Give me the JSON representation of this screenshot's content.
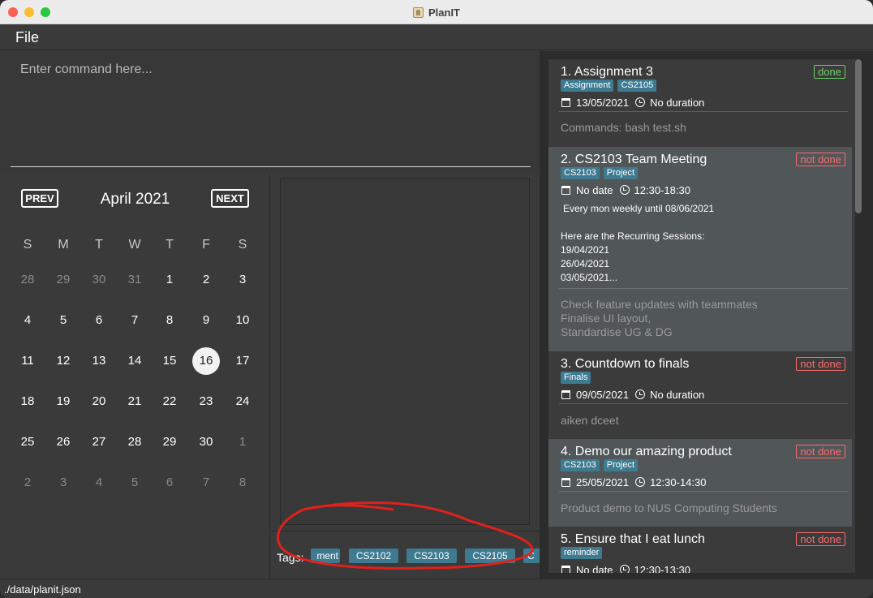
{
  "window": {
    "title": "PlanIT"
  },
  "menu": {
    "file": "File"
  },
  "command": {
    "placeholder": "Enter command here..."
  },
  "calendar": {
    "prev_label": "PREV",
    "next_label": "NEXT",
    "month_label": "April 2021",
    "weekdays": [
      "S",
      "M",
      "T",
      "W",
      "T",
      "F",
      "S"
    ],
    "weeks": [
      [
        "28",
        "29",
        "30",
        "31",
        "1",
        "2",
        "3"
      ],
      [
        "4",
        "5",
        "6",
        "7",
        "8",
        "9",
        "10"
      ],
      [
        "11",
        "12",
        "13",
        "14",
        "15",
        "16",
        "17"
      ],
      [
        "18",
        "19",
        "20",
        "21",
        "22",
        "23",
        "24"
      ],
      [
        "25",
        "26",
        "27",
        "28",
        "29",
        "30",
        "1"
      ],
      [
        "2",
        "3",
        "4",
        "5",
        "6",
        "7",
        "8"
      ]
    ],
    "selected_day": "16"
  },
  "tags_bar": {
    "label": "Tags:",
    "chips": [
      "ment",
      "CS2102",
      "CS2103",
      "CS2105",
      "C"
    ]
  },
  "tasks": [
    {
      "title": "1.  Assignment 3",
      "status": "done",
      "tags": [
        "Assignment",
        "CS2105"
      ],
      "date": "13/05/2021",
      "time": "No duration",
      "description": "Commands: bash test.sh"
    },
    {
      "title": "2.  CS2103 Team Meeting",
      "status": "not done",
      "tags": [
        "CS2103",
        "Project"
      ],
      "date": "No date",
      "time": "12:30-18:30",
      "recurrence": "Every mon weekly until 08/06/2021",
      "sessions_header": "Here are the Recurring Sessions:",
      "sessions": [
        "19/04/2021",
        "26/04/2021",
        "03/05/2021..."
      ],
      "description_lines": [
        "Check feature updates with teammates",
        "Finalise UI layout,",
        "Standardise UG & DG"
      ]
    },
    {
      "title": "3.  Countdown to finals",
      "status": "not done",
      "tags": [
        "Finals"
      ],
      "date": "09/05/2021",
      "time": "No duration",
      "description": "aiken dceet"
    },
    {
      "title": "4.  Demo our amazing product",
      "status": "not done",
      "tags": [
        "CS2103",
        "Project"
      ],
      "date": "25/05/2021",
      "time": "12:30-14:30",
      "description": "Product demo to NUS Computing Students"
    },
    {
      "title": "5.  Ensure that I eat lunch",
      "status": "not done",
      "tags": [
        "reminder"
      ],
      "date": "No date",
      "time": "12:30-13:30"
    }
  ],
  "statusbar": {
    "path": "./data/planit.json"
  },
  "colors": {
    "tag": "#3e7b91",
    "done": "#6fd067",
    "not_done": "#ff6b6b",
    "annotation": "#e0201b"
  }
}
